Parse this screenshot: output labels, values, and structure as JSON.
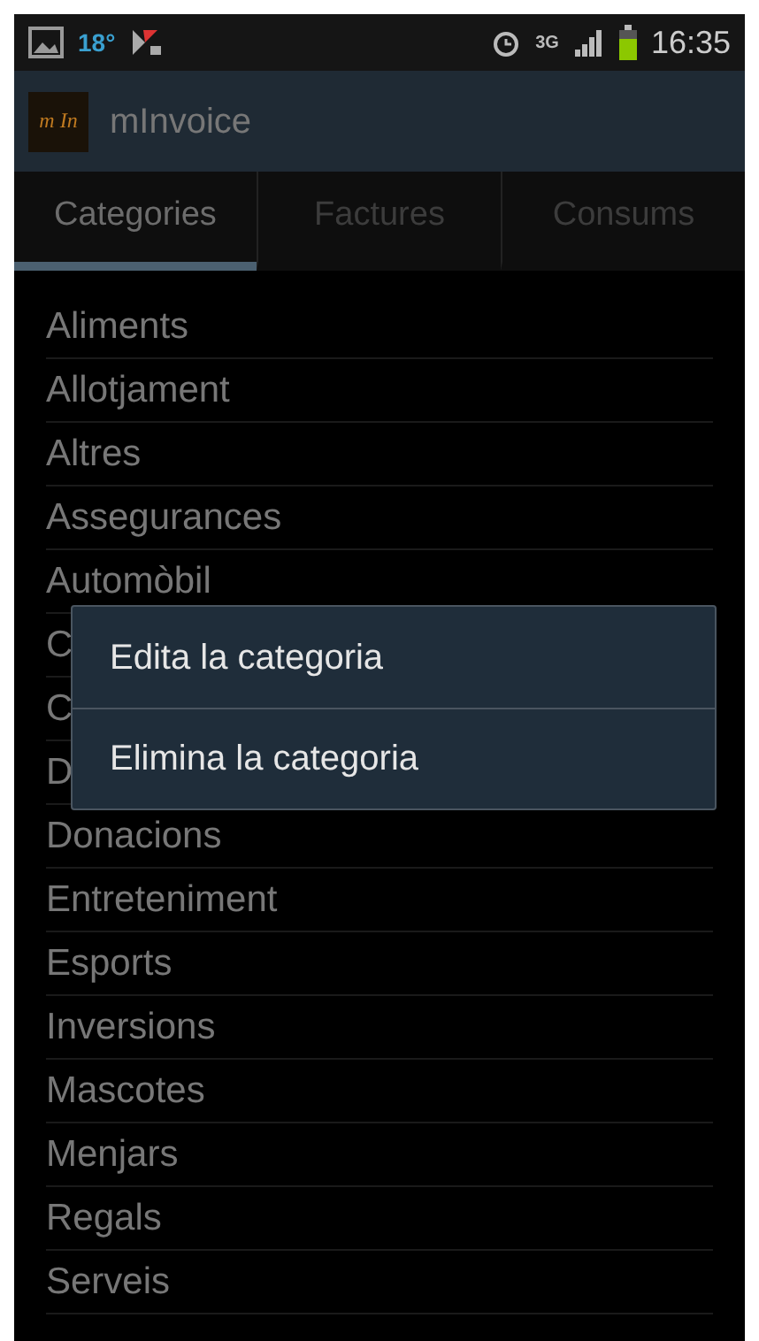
{
  "status_bar": {
    "temperature": "18°",
    "network": "3G",
    "time": "16:35"
  },
  "app_bar": {
    "logo": "m In",
    "title": "mInvoice"
  },
  "tabs": [
    {
      "label": "Categories",
      "selected": true
    },
    {
      "label": "Factures",
      "selected": false
    },
    {
      "label": "Consums",
      "selected": false
    }
  ],
  "categories": [
    "Aliments",
    "Allotjament",
    "Altres",
    "Assegurances",
    "Automòbil",
    "C",
    "C",
    "D",
    "Donacions",
    "Entreteniment",
    "Esports",
    "Inversions",
    "Mascotes",
    "Menjars",
    "Regals",
    "Serveis"
  ],
  "context_menu": [
    "Edita la categoria",
    "Elimina la categoria"
  ]
}
